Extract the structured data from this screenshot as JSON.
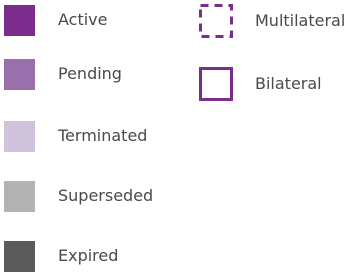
{
  "legend": {
    "status_items": [
      {
        "label": "Active",
        "color": "#7b2d8e"
      },
      {
        "label": "Pending",
        "color": "#9a70ac"
      },
      {
        "label": "Terminated",
        "color": "#cfc4db"
      },
      {
        "label": "Superseded",
        "color": "#b3b3b3"
      },
      {
        "label": "Expired",
        "color": "#5a5a5a"
      }
    ],
    "type_items": [
      {
        "label": "Multilateral",
        "style": "dashed-outline",
        "color": "#7b2d8e"
      },
      {
        "label": "Bilateral",
        "style": "solid-outline",
        "color": "#7b2d8e"
      }
    ]
  }
}
